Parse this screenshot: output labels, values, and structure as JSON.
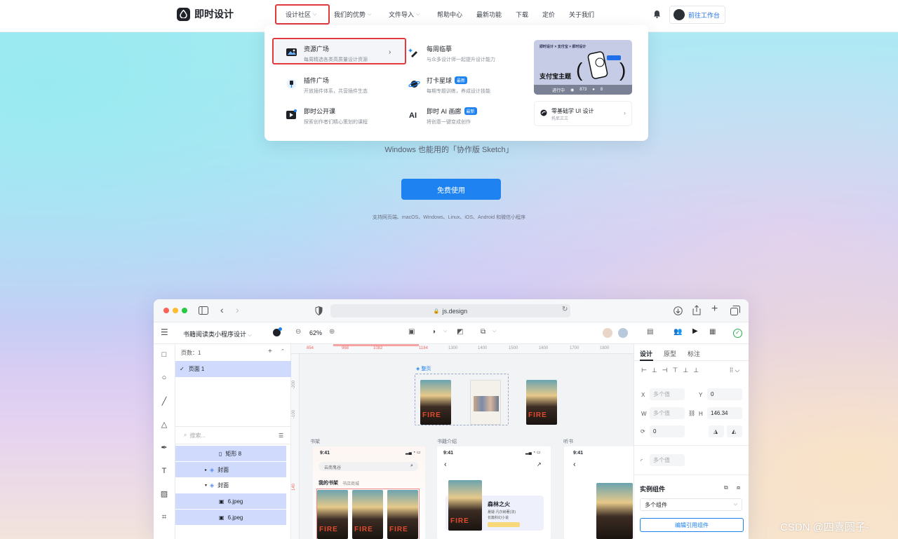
{
  "nav": {
    "logo_text": "即时设计",
    "items": [
      {
        "label": "设计社区",
        "has_chevron": true
      },
      {
        "label": "我们的优势",
        "has_chevron": true
      },
      {
        "label": "文件导入",
        "has_chevron": true
      },
      {
        "label": "帮助中心",
        "has_chevron": false
      },
      {
        "label": "最新功能",
        "has_chevron": false
      },
      {
        "label": "下载",
        "has_chevron": false
      },
      {
        "label": "定价",
        "has_chevron": false
      },
      {
        "label": "关于我们",
        "has_chevron": false
      }
    ],
    "cta_label": "前往工作台",
    "colors": {
      "accent": "#1e83f0",
      "highlight": "#e0393e"
    }
  },
  "dropdown": {
    "items": [
      {
        "title": "资源广场",
        "subtitle": "每周精选各类高质量设计资源",
        "icon": "image-icon",
        "badge": ""
      },
      {
        "title": "每周临摹",
        "subtitle": "与众多设计师一起提升设计能力",
        "icon": "pen-sparkle-icon",
        "badge": ""
      },
      {
        "title": "插件广场",
        "subtitle": "开放插件体系，共营插件生态",
        "icon": "plug-icon",
        "badge": ""
      },
      {
        "title": "打卡星球",
        "subtitle": "每期专题训练，养成设计技能",
        "icon": "planet-icon",
        "badge": "最新"
      },
      {
        "title": "即时公开课",
        "subtitle": "探索创作者们精心策划的课程",
        "icon": "video-icon",
        "badge": ""
      },
      {
        "title": "即时 AI 画廊",
        "subtitle": "将创意一键变成创作",
        "icon": "ai-icon",
        "badge": "最新"
      }
    ],
    "promo": {
      "header": "即时设计 × 支付宝 × 即时设计",
      "title": "支付宝主题",
      "status": "进行中",
      "views": "873",
      "users": "8"
    },
    "course": {
      "title": "零基础学 UI 设计",
      "author": "托尼三三"
    }
  },
  "hero": {
    "subtitle": "Windows 也能用的「协作版 Sketch」",
    "button_label": "免费使用",
    "platforms": "支持网页端、macOS、Windows、Linux、iOS、Android 和微信小程序"
  },
  "app": {
    "url": "js.design",
    "file_name": "书籍阅读类小程序设计",
    "zoom": "62%",
    "layers": {
      "page_count_label": "页数：1",
      "page_label": "页面 1",
      "search_placeholder": "搜索...",
      "rows": [
        {
          "label": "矩形 8",
          "selected": true,
          "indent": 62
        },
        {
          "label": "封面",
          "selected": true,
          "indent": 50
        },
        {
          "label": "封面",
          "selected": false,
          "indent": 50
        },
        {
          "label": "6.jpeg",
          "selected": true,
          "indent": 62
        },
        {
          "label": "6.jpeg",
          "selected": true,
          "indent": 62
        }
      ]
    },
    "ruler": {
      "x_ticks": [
        {
          "v": "854",
          "red": true
        },
        {
          "v": "968",
          "red": true
        },
        {
          "v": "1082",
          "red": true
        },
        {
          "v": "1184",
          "red": true
        },
        {
          "v": "1300",
          "red": false
        },
        {
          "v": "1400",
          "red": false
        },
        {
          "v": "1500",
          "red": false
        },
        {
          "v": "1600",
          "red": false
        },
        {
          "v": "1700",
          "red": false
        },
        {
          "v": "1800",
          "red": false
        }
      ],
      "y_ticks": [
        "-200",
        "-100",
        "140"
      ]
    },
    "canvas": {
      "frame_cover_label": "整页",
      "frame_shelf_label": "书架",
      "frame_intro_label": "书籍介绍",
      "frame_listen_label": "听书",
      "time": "9:41",
      "search_text": "云南鬼谷",
      "tab_active": "我的书架",
      "tab_other": "书店商城",
      "cover_text": "FIRE",
      "book_title": "森林之火",
      "book_meta": "悬疑·凡尔纳著(法)",
      "book_meta2": "长篇科幻小说"
    },
    "right_panel": {
      "tabs": [
        "设计",
        "原型",
        "标注"
      ],
      "x_label": "X",
      "x_value": "多个值",
      "y_label": "Y",
      "y_value": "0",
      "w_label": "W",
      "w_value": "多个值",
      "h_label": "H",
      "h_value": "146.34",
      "rot_value": "0",
      "radius_value": "多个值",
      "component_title": "实例组件",
      "component_select": "多个组件",
      "edit_button": "编辑引用组件"
    }
  },
  "watermark": "CSDN @四喜圆子-"
}
